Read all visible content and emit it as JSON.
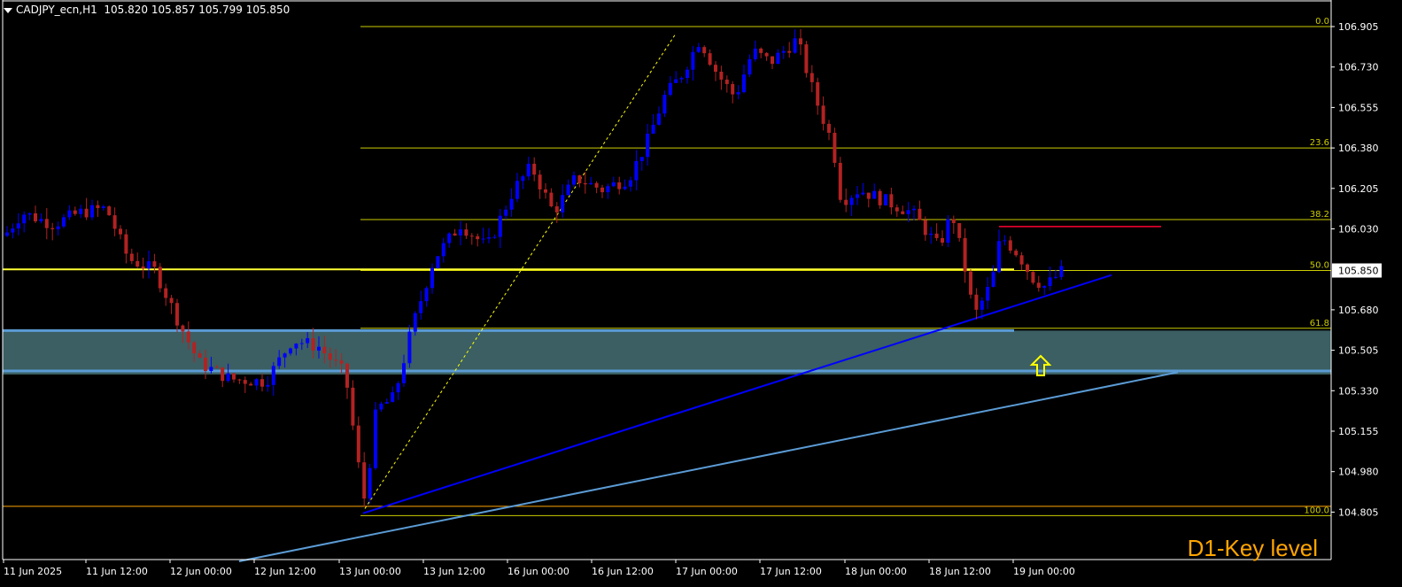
{
  "header": {
    "symbol": "CADJPY_ecn,H1",
    "ohlc": "105.820 105.857 105.799 105.850"
  },
  "watermark": "D1-Key level",
  "colors": {
    "background": "#000000",
    "axis": "#ffffff",
    "bull_candle": "#0000ff",
    "bear_candle": "#b22222",
    "fib": "#cccc00",
    "support_zone": "#3b5f62",
    "support_zone_border": "#5b9bd5",
    "trendline": "#0000ff",
    "trendline_lower": "#5b9bd5",
    "resistance_marker": "#ff0033",
    "watermark": "#ffa500",
    "arrow": "#ffff00"
  },
  "chart_data": {
    "type": "candlestick",
    "y_ticks": [
      "106.905",
      "106.730",
      "106.555",
      "106.380",
      "106.205",
      "106.030",
      "105.850",
      "105.680",
      "105.505",
      "105.330",
      "105.155",
      "104.980",
      "104.805"
    ],
    "current_price": "105.850",
    "x_ticks": [
      "11 Jun 2025",
      "11 Jun 12:00",
      "12 Jun 00:00",
      "12 Jun 12:00",
      "13 Jun 00:00",
      "13 Jun 12:00",
      "16 Jun 00:00",
      "16 Jun 12:00",
      "17 Jun 00:00",
      "17 Jun 12:00",
      "18 Jun 00:00",
      "18 Jun 12:00",
      "19 Jun 00:00"
    ],
    "fib_levels": [
      {
        "label": "0.0",
        "price": 106.905
      },
      {
        "label": "23.6",
        "price": 106.38
      },
      {
        "label": "38.2",
        "price": 106.07
      },
      {
        "label": "50.0",
        "price": 105.85
      },
      {
        "label": "61.8",
        "price": 105.6
      },
      {
        "label": "100.0",
        "price": 104.79
      }
    ],
    "key_zone": {
      "high": 105.59,
      "low": 105.4
    },
    "horizontal_line": 105.855,
    "bottom_line": 104.83,
    "resistance_line": 106.04
  }
}
